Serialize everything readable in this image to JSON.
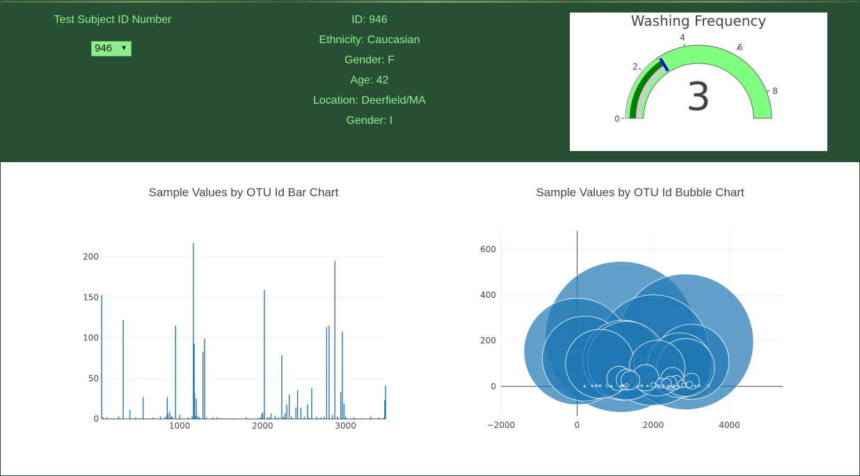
{
  "selector": {
    "label": "Test Subject ID Number",
    "value": "946"
  },
  "metadata": [
    "ID: 946",
    "Ethnicity: Caucasian",
    "Gender: F",
    "Age: 42",
    "Location: Deerfield/MA",
    "Gender: I"
  ],
  "gauge": {
    "title": "Washing Frequency",
    "value_display": "3",
    "ticks": [
      "0",
      "2",
      "4",
      "6",
      "8"
    ]
  },
  "colors": {
    "header_bg": "#274f34",
    "header_text": "#8df08c",
    "gauge_green": "#008000",
    "gauge_light": "#80ff80",
    "bar_blue": "#1f77b4"
  },
  "chart_data": [
    {
      "type": "bar",
      "title": "Sample Values by OTU Id Bar Chart",
      "x_ticks": [
        "1000",
        "2000",
        "3000"
      ],
      "y_ticks": [
        "0",
        "50",
        "100",
        "150",
        "200"
      ],
      "xlim": [
        60,
        3480
      ],
      "ylim": [
        0,
        225
      ],
      "x": [
        60,
        80,
        120,
        200,
        265,
        320,
        400,
        470,
        560,
        680,
        770,
        830,
        850,
        860,
        880,
        900,
        910,
        950,
        1000,
        1100,
        1150,
        1165,
        1175,
        1180,
        1190,
        1200,
        1220,
        1240,
        1280,
        1300,
        1320,
        1400,
        1450,
        1500,
        1640,
        1800,
        1950,
        1970,
        1990,
        2000,
        2020,
        2060,
        2080,
        2100,
        2150,
        2190,
        2230,
        2250,
        2270,
        2290,
        2320,
        2350,
        2400,
        2420,
        2460,
        2500,
        2540,
        2560,
        2590,
        2650,
        2700,
        2740,
        2770,
        2800,
        2840,
        2870,
        2900,
        2940,
        2960,
        2980,
        3000,
        3100,
        3200,
        3300,
        3400,
        3460,
        3470,
        3480
      ],
      "y": [
        153,
        2,
        2,
        1,
        3,
        122,
        11,
        2,
        27,
        2,
        3,
        3,
        27,
        6,
        9,
        3,
        3,
        115,
        5,
        2,
        3,
        217,
        93,
        32,
        3,
        25,
        4,
        2,
        83,
        99,
        2,
        2,
        2,
        1,
        1,
        2,
        1,
        2,
        6,
        8,
        159,
        2,
        2,
        7,
        4,
        2,
        79,
        3,
        7,
        18,
        30,
        3,
        14,
        35,
        14,
        3,
        18,
        2,
        38,
        3,
        2,
        3,
        113,
        115,
        5,
        195,
        3,
        33,
        108,
        19,
        3,
        2,
        1,
        3,
        2,
        1,
        23,
        41
      ]
    },
    {
      "type": "scatter",
      "title": "Sample Values by OTU Id Bubble Chart",
      "x_ticks": [
        "−2000",
        "0",
        "2000",
        "4000"
      ],
      "y_ticks": [
        "0",
        "200",
        "400",
        "600"
      ],
      "xlim": [
        -2000,
        5400
      ],
      "ylim": [
        -130,
        680
      ],
      "x": [
        1150,
        2850,
        0,
        2000,
        200,
        1200,
        1300,
        600,
        3000,
        2100,
        2700,
        2850,
        1400,
        1100,
        1300,
        1800,
        2500,
        2750,
        2950,
        3200,
        3450,
        500,
        800,
        900,
        1200,
        1300,
        1700,
        1850,
        2000,
        2200,
        2350,
        2450,
        2600,
        2800,
        3000,
        3100,
        2150,
        2250,
        2400,
        2500,
        1150,
        1200,
        1600,
        2550,
        2650,
        200,
        400,
        600
      ],
      "y": [
        217,
        195,
        153,
        159,
        122,
        115,
        113,
        99,
        108,
        80,
        93,
        83,
        27,
        35,
        30,
        38,
        33,
        11,
        9,
        3,
        3,
        3,
        4,
        1,
        3,
        5,
        3,
        2,
        7,
        14,
        14,
        18,
        19,
        6,
        23,
        2,
        3,
        3,
        2,
        1,
        2,
        2,
        1,
        1,
        2,
        1,
        2,
        3
      ],
      "marker_size": [
        217,
        195,
        153,
        159,
        122,
        115,
        113,
        99,
        108,
        80,
        93,
        83,
        27,
        35,
        30,
        38,
        33,
        11,
        9,
        3,
        3,
        3,
        4,
        1,
        3,
        5,
        3,
        2,
        7,
        14,
        14,
        18,
        19,
        6,
        23,
        2,
        3,
        3,
        2,
        1,
        2,
        2,
        1,
        1,
        2,
        1,
        2,
        3
      ]
    }
  ]
}
